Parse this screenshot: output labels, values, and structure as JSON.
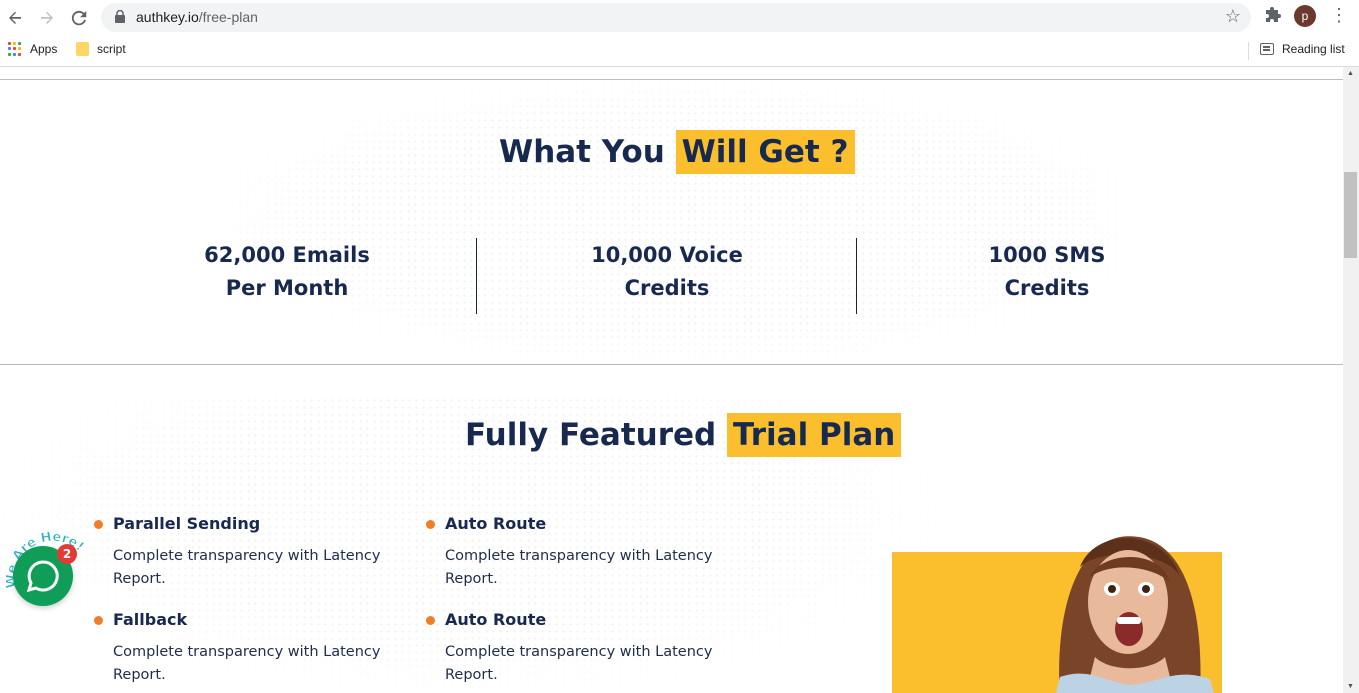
{
  "browser": {
    "url_host": "authkey.io",
    "url_path": "/free-plan",
    "profile_initial": "p",
    "bookmarks": [
      {
        "label": "Apps",
        "icon": "apps-grid-icon"
      },
      {
        "label": "script",
        "icon": "folder-icon"
      }
    ],
    "reading_list_label": "Reading list"
  },
  "section_benefits": {
    "heading_main": "What You",
    "heading_highlight": "Will Get ?",
    "stats": [
      {
        "line1": "62,000 Emails",
        "line2": "Per Month"
      },
      {
        "line1": "10,000 Voice",
        "line2": "Credits"
      },
      {
        "line1": "1000 SMS",
        "line2": "Credits"
      }
    ]
  },
  "section_trial": {
    "heading_main": "Fully Featured",
    "heading_highlight": "Trial Plan",
    "features": [
      {
        "title": "Parallel Sending",
        "desc": "Complete transparency with Latency Report."
      },
      {
        "title": "Auto Route",
        "desc": "Complete transparency with Latency Report."
      },
      {
        "title": "Fallback",
        "desc": "Complete transparency with Latency Report."
      },
      {
        "title": "Auto Route",
        "desc": "Complete transparency with Latency Report."
      }
    ]
  },
  "chat_widget": {
    "tagline": "We Are Here!",
    "badge_count": "2"
  },
  "colors": {
    "navy": "#18294f",
    "highlight_yellow": "#fbbf2e",
    "bullet_orange": "#f07d2a",
    "chat_green": "#0f9d58",
    "badge_red": "#e53935"
  }
}
